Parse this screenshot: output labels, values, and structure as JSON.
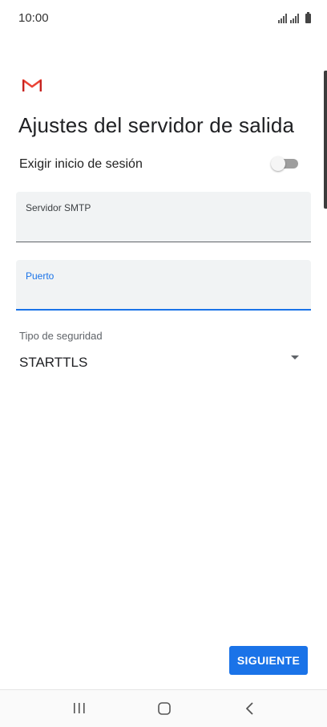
{
  "status_bar": {
    "time": "10:00"
  },
  "header": {
    "app_icon": "gmail-icon",
    "title": "Ajustes del servidor de salida"
  },
  "require_login": {
    "label": "Exigir inicio de sesión",
    "enabled": false
  },
  "smtp_server": {
    "label": "Servidor SMTP",
    "value": ""
  },
  "port": {
    "label": "Puerto",
    "value": "",
    "focused": true
  },
  "security_type": {
    "label": "Tipo de seguridad",
    "selected": "STARTTLS"
  },
  "actions": {
    "next_label": "SIGUIENTE"
  },
  "colors": {
    "accent": "#1a73e8",
    "gmail_red": "#ea4335",
    "field_bg": "#f1f3f4"
  },
  "nav_bar": {
    "recent_icon": "recent-apps-icon",
    "home_icon": "home-icon",
    "back_icon": "back-icon"
  }
}
